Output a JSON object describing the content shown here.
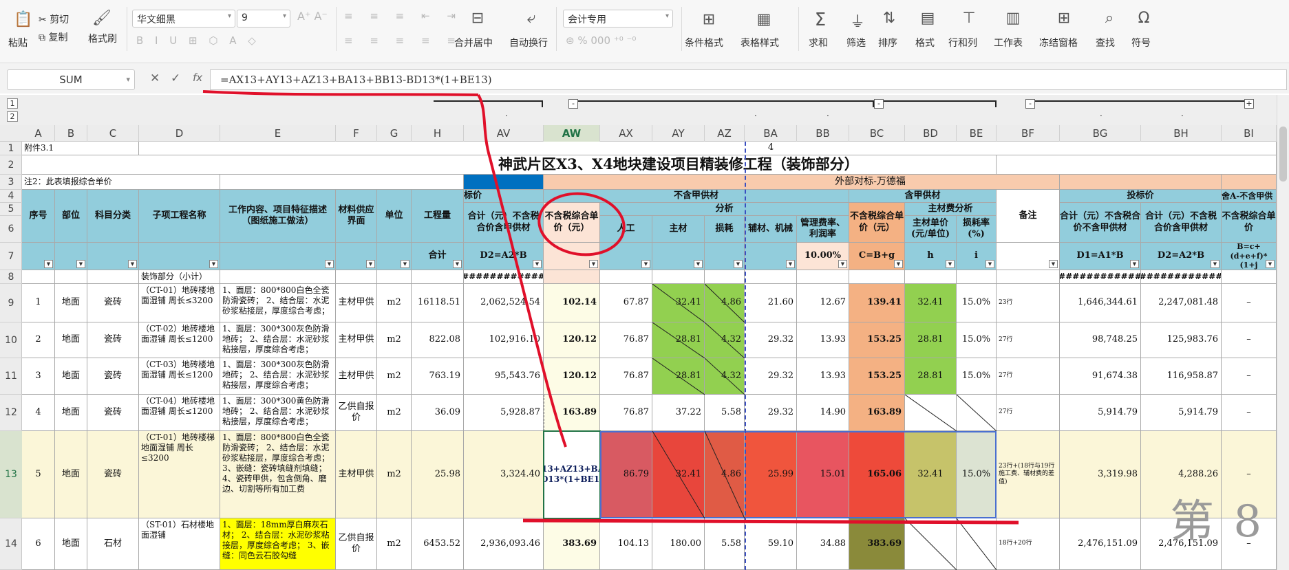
{
  "ribbon": {
    "paste": "粘贴",
    "cut": "剪切",
    "copy": "复制",
    "format_painter": "格式刷",
    "font_name": "华文细黑",
    "font_size": "9",
    "number_format": "会计专用",
    "merge_center": "合并居中",
    "wrap_text": "自动换行",
    "cond_format": "条件格式",
    "table_style": "表格样式",
    "sum": "求和",
    "filter": "筛选",
    "sort": "排序",
    "format": "格式",
    "row_col": "行和列",
    "worksheet": "工作表",
    "freeze": "冻结窗格",
    "find": "查找",
    "symbol": "符号",
    "percent": "%",
    "thousands": "000"
  },
  "formula_bar": {
    "name_box": "SUM",
    "fx": "fx",
    "formula": "=AX13+AY13+AZ13+BA13+BB13-BD13*(1+BE13)"
  },
  "outline": {
    "level1": "1",
    "level2": "2",
    "minus": "-",
    "plus": "+",
    "dot": "."
  },
  "columns": [
    "A",
    "B",
    "C",
    "D",
    "E",
    "F",
    "G",
    "H",
    "AV",
    "AW",
    "AX",
    "AY",
    "AZ",
    "BA",
    "BB",
    "BC",
    "BD",
    "BE",
    "BF",
    "BG",
    "BH",
    "BI"
  ],
  "rows": [
    "1",
    "2",
    "3",
    "4",
    "5",
    "6",
    "7",
    "8",
    "9",
    "10",
    "11",
    "12",
    "13",
    "14"
  ],
  "sheet": {
    "r1_a": "附件3.1",
    "r1_num": "4",
    "title": "神武片区X3、X4地块建设项目精装修工程（装饰部分）",
    "note": "注2：此表填报综合单价",
    "outside_bid": "外部对标-万德福",
    "h_price": "标价",
    "h_no_a": "不含甲供材",
    "h_with_a": "含甲供材",
    "h_bid": "投标价",
    "h_bi": "舍A-不含甲供",
    "h_analysis": "分析",
    "h_main_fee": "主材费分析",
    "col_seq": "序号",
    "col_part": "部位",
    "col_subject": "科目分类",
    "col_sub_name": "子项工程名称",
    "col_work": "工作内容、项目特征描述（图纸施工做法）",
    "col_material_iface": "材料供应界面",
    "col_unit": "单位",
    "col_qty": "工程量",
    "col_av": "合计（元）不含税合价含甲供材",
    "col_aw": "不含税综合单价（元）",
    "col_ax": "人工",
    "col_ay": "主材",
    "col_az": "损耗",
    "col_ba": "辅材、机械",
    "col_bb": "管理费率、利润率",
    "col_bc": "不含税综合单价（元）",
    "col_bd": "主材单价(元/单位)",
    "col_be": "损耗率(%)",
    "col_bf": "备注",
    "col_bg": "合计（元）不含税合价不含甲供材",
    "col_bh": "合计（元）不含税合价含甲供材",
    "col_bi": "不含税综合单价",
    "r7_h": "合计",
    "r7_av": "D2=A2*B",
    "r7_bb": "10.00%",
    "r7_bc": "C=B+g",
    "r7_bd": "h",
    "r7_be": "i",
    "r7_bg": "D1=A1*B",
    "r7_bh": "D2=A2*B",
    "r7_bi": "B=c+(d+e+f)*(1+j",
    "r8_d": "装饰部分（小计）",
    "hashes": "############"
  },
  "data_rows": [
    {
      "seq": "1",
      "part": "地面",
      "subj": "瓷砖",
      "name": "（CT-01）地砖楼地面湿铺 周长≤3200",
      "work": "1、面层：800*800白色全瓷防滑瓷砖；\n2、结合层：水泥砂浆粘接层，厚度综合考虑；",
      "iface": "主材甲供",
      "unit": "m2",
      "qty": "16118.51",
      "av": "2,062,524.54",
      "aw": "102.14",
      "ax": "67.87",
      "ay": "32.41",
      "az": "4.86",
      "ba": "21.60",
      "bb": "12.67",
      "bc": "139.41",
      "bd": "32.41",
      "be": "15.0%",
      "bf": "23行",
      "bg": "1,646,344.61",
      "bh": "2,247,081.48",
      "bi": "–"
    },
    {
      "seq": "2",
      "part": "地面",
      "subj": "瓷砖",
      "name": "（CT-02）地砖楼地面湿铺 周长≤1200",
      "work": "1、面层：300*300灰色防滑地砖；\n2、结合层：水泥砂浆粘接层，厚度综合考虑；",
      "iface": "主材甲供",
      "unit": "m2",
      "qty": "822.08",
      "av": "102,916.10",
      "aw": "120.12",
      "ax": "76.87",
      "ay": "28.81",
      "az": "4.32",
      "ba": "29.32",
      "bb": "13.93",
      "bc": "153.25",
      "bd": "28.81",
      "be": "15.0%",
      "bf": "27行",
      "bg": "98,748.25",
      "bh": "125,983.76",
      "bi": "–"
    },
    {
      "seq": "3",
      "part": "地面",
      "subj": "瓷砖",
      "name": "（CT-03）地砖楼地面湿铺 周长≤1200",
      "work": "1、面层：300*300灰色防滑地砖；\n2、结合层：水泥砂浆粘接层，厚度综合考虑；",
      "iface": "主材甲供",
      "unit": "m2",
      "qty": "763.19",
      "av": "95,543.76",
      "aw": "120.12",
      "ax": "76.87",
      "ay": "28.81",
      "az": "4.32",
      "ba": "29.32",
      "bb": "13.93",
      "bc": "153.25",
      "bd": "28.81",
      "be": "15.0%",
      "bf": "27行",
      "bg": "91,674.38",
      "bh": "116,958.87",
      "bi": "–"
    },
    {
      "seq": "4",
      "part": "地面",
      "subj": "瓷砖",
      "name": "（CT-04）地砖楼地面湿铺 周长≤1200",
      "work": "1、面层：300*300黄色防滑地砖；\n2、结合层：水泥砂浆粘接层，厚度综合考虑；",
      "iface": "乙供自报价",
      "unit": "m2",
      "qty": "36.09",
      "av": "5,928.87",
      "aw": "163.89",
      "ax": "76.87",
      "ay": "37.22",
      "az": "5.58",
      "ba": "29.32",
      "bb": "14.90",
      "bc": "163.89",
      "bd": "",
      "be": "",
      "bf": "27行",
      "bg": "5,914.79",
      "bh": "5,914.79",
      "bi": "–"
    },
    {
      "seq": "5",
      "part": "地面",
      "subj": "瓷砖",
      "name": "（CT-01）地砖楼梯地面湿铺 周长≤3200",
      "work": "1、面层：800*800白色全瓷防滑瓷砖；\n2、结合层：水泥砂浆粘接层，厚度综合考虑；\n3、嵌缝：瓷砖填缝剂填缝；\n4、瓷砖甲供，包含倒角、磨边、切割等所有加工费",
      "iface": "主材甲供",
      "unit": "m2",
      "qty": "25.98",
      "av": "3,324.40",
      "aw": "=AX13+AY13+AZ13+BA13+BB13-BD13*(1+BE13)",
      "ax": "86.79",
      "ay": "32.41",
      "az": "4.86",
      "ba": "25.99",
      "bb": "15.01",
      "bc": "165.06",
      "bd": "32.41",
      "be": "15.0%",
      "bf": "23行+(18行与19行施工费、辅材费的差值)",
      "bg": "3,319.98",
      "bh": "4,288.26",
      "bi": "–"
    },
    {
      "seq": "6",
      "part": "地面",
      "subj": "石材",
      "name": "（ST-01）石材楼地面湿铺",
      "work": "1、面层：18mm厚白麻灰石材；\n2、结合层：水泥砂浆粘接层，厚度综合考虑；\n3、嵌缝：同色云石胶勾缝",
      "iface": "乙供自报价",
      "unit": "m2",
      "qty": "6453.52",
      "av": "2,936,093.46",
      "aw": "383.69",
      "ax": "104.13",
      "ay": "180.00",
      "az": "5.58",
      "ba": "59.10",
      "bb": "34.88",
      "bc": "383.69",
      "bd": "",
      "be": "",
      "bf": "18行+20行",
      "bg": "2,476,151.09",
      "bh": "2,476,151.09",
      "bi": "–"
    }
  ],
  "watermark": "第 8",
  "colors": {
    "header_blue": "#92cddc",
    "orange": "#f4b183",
    "green": "#92d050",
    "light_yellow": "#fdfce6",
    "selection": "#217346",
    "annotation_red": "#e0102a"
  }
}
